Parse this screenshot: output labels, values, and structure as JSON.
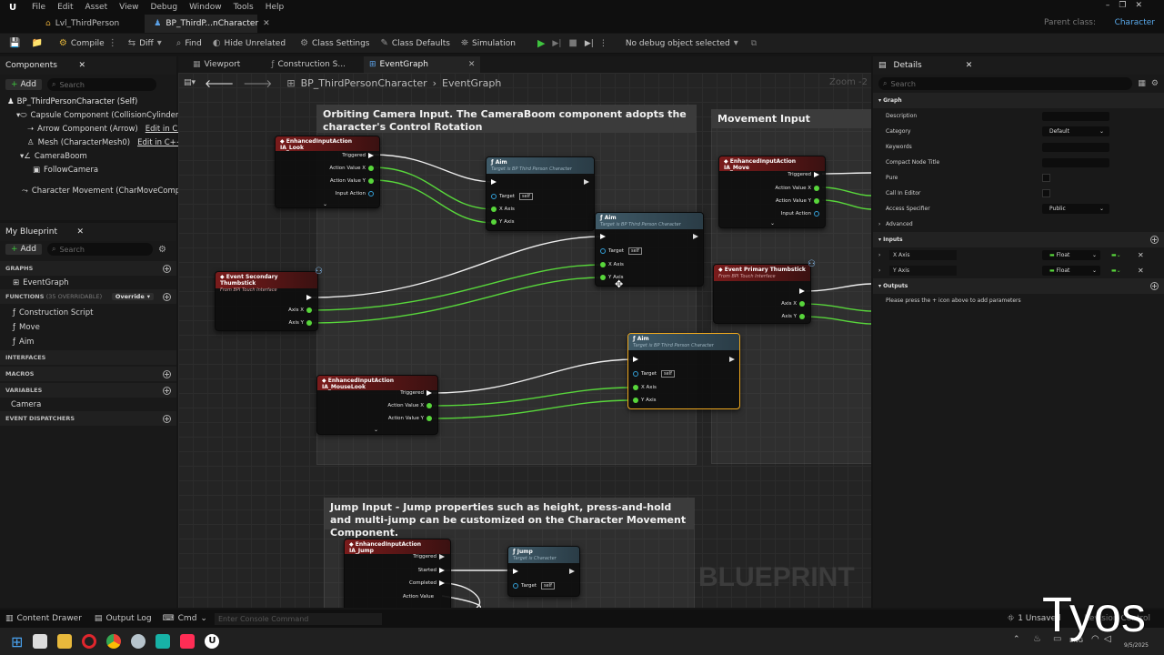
{
  "app": {
    "menu": [
      "File",
      "Edit",
      "Asset",
      "View",
      "Debug",
      "Window",
      "Tools",
      "Help"
    ],
    "tabs": [
      {
        "label": "Lvl_ThirdPerson",
        "active": false
      },
      {
        "label": "BP_ThirdP...nCharacter",
        "active": true
      }
    ],
    "parent_class_label": "Parent class:",
    "parent_class_value": "Character"
  },
  "toolbar": {
    "compile": "Compile",
    "diff": "Diff",
    "find": "Find",
    "hide_unrelated": "Hide Unrelated",
    "class_settings": "Class Settings",
    "class_defaults": "Class Defaults",
    "simulation": "Simulation",
    "debug_object": "No debug object selected"
  },
  "components": {
    "tab": "Components",
    "add": "Add",
    "search_placeholder": "Search",
    "items": {
      "self": "BP_ThirdPersonCharacter (Self)",
      "capsule": "Capsule Component (CollisionCylinder)",
      "arrow": "Arrow Component (Arrow)",
      "mesh": "Mesh (CharacterMesh0)",
      "boom": "CameraBoom",
      "follow": "FollowCamera",
      "movement": "Character Movement (CharMoveComp)"
    },
    "edit_link": "Edit in C++"
  },
  "my_blueprint": {
    "tab": "My Blueprint",
    "add": "Add",
    "search_placeholder": "Search",
    "graphs_header": "GRAPHS",
    "event_graph": "EventGraph",
    "functions_header": "FUNCTIONS",
    "functions_count": "(35 OVERRIDABLE)",
    "override": "Override",
    "functions": [
      "Construction Script",
      "Move",
      "Aim"
    ],
    "interfaces_header": "INTERFACES",
    "macros_header": "MACROS",
    "variables_header": "VARIABLES",
    "variables": [
      "Camera"
    ],
    "dispatchers_header": "EVENT DISPATCHERS"
  },
  "editor_tabs": [
    "Viewport",
    "Construction S...",
    "EventGraph"
  ],
  "breadcrumb": {
    "root": "BP_ThirdPersonCharacter",
    "leaf": "EventGraph"
  },
  "zoom": "Zoom -2",
  "watermark": "BLUEPRINT",
  "comments": {
    "camera": "Orbiting Camera Input. The CameraBoom component adopts the character's Control Rotation",
    "movement": "Movement Input",
    "jump": "Jump Input - Jump properties such as height, press-and-hold and multi-jump can be customized on the Character Movement Component."
  },
  "nodes": {
    "look": {
      "title": "EnhancedInputAction IA_Look",
      "pins": [
        "Triggered",
        "Action Value X",
        "Action Value Y",
        "Input Action"
      ]
    },
    "aim1": {
      "title": "Aim",
      "sub": "Target is BP Third Person Character",
      "pins": [
        "Target",
        "X Axis",
        "Y Axis"
      ],
      "self": "self"
    },
    "aim2": {
      "title": "Aim",
      "sub": "Target is BP Third Person Character",
      "pins": [
        "Target",
        "X Axis",
        "Y Axis"
      ],
      "self": "self"
    },
    "aim3": {
      "title": "Aim",
      "sub": "Target is BP Third Person Character",
      "pins": [
        "Target",
        "X Axis",
        "Y Axis"
      ],
      "self": "self"
    },
    "sec_thumb": {
      "title": "Event Secondary Thumbstick",
      "sub": "From BPI Touch Interface",
      "pins": [
        "Axis X",
        "Axis Y"
      ]
    },
    "mouselook": {
      "title": "EnhancedInputAction IA_MouseLook",
      "pins": [
        "Triggered",
        "Action Value X",
        "Action Value Y"
      ]
    },
    "move": {
      "title": "EnhancedInputAction IA_Move",
      "pins": [
        "Triggered",
        "Action Value X",
        "Action Value Y",
        "Input Action"
      ]
    },
    "prim_thumb": {
      "title": "Event Primary Thumbstick",
      "sub": "From BPI Touch Interface",
      "pins": [
        "Axis X",
        "Axis Y"
      ]
    },
    "jump_in": {
      "title": "EnhancedInputAction IA_Jump",
      "pins": [
        "Triggered",
        "Started",
        "Completed",
        "Action Value"
      ]
    },
    "jump": {
      "title": "Jump",
      "sub": "Target is Character",
      "pins": [
        "Target"
      ],
      "self": "self"
    }
  },
  "details": {
    "tab": "Details",
    "search_placeholder": "Search",
    "graph_header": "Graph",
    "rows": {
      "description": "Description",
      "category": "Category",
      "category_value": "Default",
      "keywords": "Keywords",
      "compact": "Compact Node Title",
      "pure": "Pure",
      "call_editor": "Call In Editor",
      "access": "Access Specifier",
      "access_value": "Public"
    },
    "advanced": "Advanced",
    "inputs_header": "Inputs",
    "inputs": [
      {
        "name": "X Axis",
        "type": "Float"
      },
      {
        "name": "Y Axis",
        "type": "Float"
      }
    ],
    "outputs_header": "Outputs",
    "outputs_hint": "Please press the + icon above to add parameters"
  },
  "statusbar": {
    "content_drawer": "Content Drawer",
    "output_log": "Output Log",
    "cmd": "Cmd",
    "console_placeholder": "Enter Console Command",
    "unsaved": "1 Unsaved",
    "revision": "Revision Control"
  },
  "taskbar": {
    "lang": "ENG",
    "date": "9/5/2025"
  },
  "overlay_brand": "Tyos"
}
